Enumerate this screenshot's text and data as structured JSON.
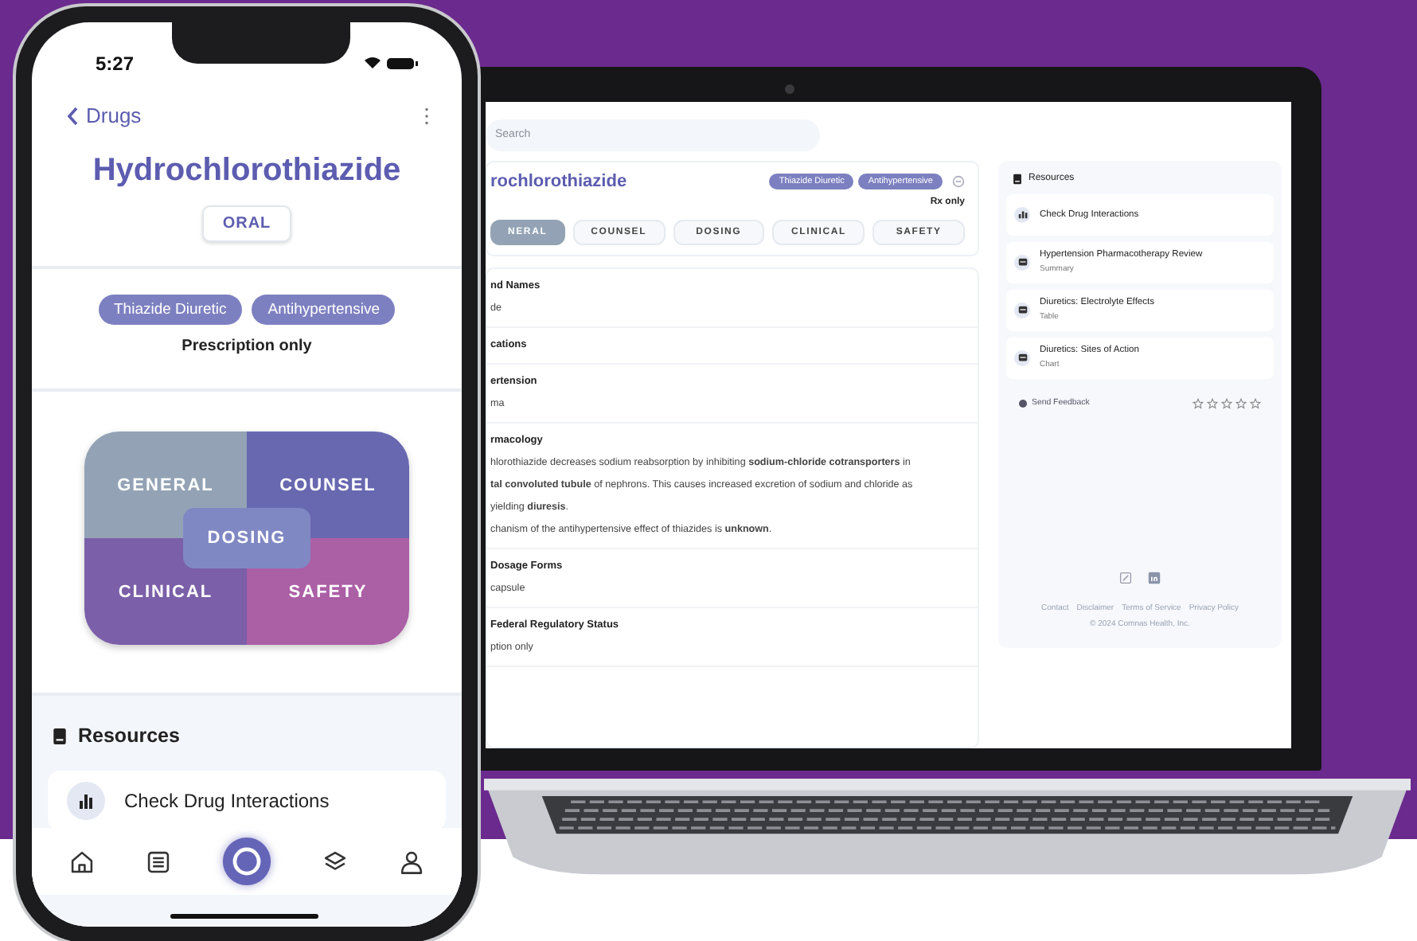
{
  "laptop": {
    "search": {
      "placeholder": "Search"
    },
    "drug": {
      "title": "rochlorothiazide",
      "tags": [
        "Thiazide Diuretic",
        "Antihypertensive"
      ],
      "rx": "Rx only"
    },
    "tabs": [
      {
        "label": "NERAL",
        "selected": true
      },
      {
        "label": "COUNSEL",
        "selected": false
      },
      {
        "label": "DOSING",
        "selected": false
      },
      {
        "label": "CLINICAL",
        "selected": false
      },
      {
        "label": "SAFETY",
        "selected": false
      }
    ],
    "sections": [
      {
        "heading": "nd Names",
        "lines": [
          "de"
        ]
      },
      {
        "heading": "cations"
      },
      {
        "heading": "ertension",
        "lines": [
          "ma"
        ]
      },
      {
        "heading": "rmacology",
        "lines": [
          "hlorothiazide decreases sodium reabsorption by inhibiting **sodium-chloride cotransporters** in",
          "**tal convoluted tubule** of nephrons. This causes increased excretion of sodium and chloride as",
          "yielding **diuresis**.",
          "chanism of the antihypertensive effect of thiazides is **unknown**."
        ]
      },
      {
        "heading": "Dosage Forms",
        "lines": [
          "capsule"
        ]
      },
      {
        "heading": "Federal Regulatory Status",
        "lines": [
          "ption only"
        ]
      }
    ],
    "resources": {
      "title": "Resources",
      "items": [
        {
          "title": "Check Drug Interactions",
          "kind": "chart"
        },
        {
          "title": "Hypertension Pharmacotherapy Review",
          "subtitle": "Summary",
          "kind": "doc"
        },
        {
          "title": "Diuretics: Electrolyte Effects",
          "subtitle": "Table",
          "kind": "doc"
        },
        {
          "title": "Diuretics: Sites of Action",
          "subtitle": "Chart",
          "kind": "doc"
        }
      ]
    },
    "feedback": "Send Feedback",
    "stars": 0,
    "footer_links": [
      "Contact",
      "Disclaimer",
      "Terms of Service",
      "Privacy Policy"
    ],
    "copyright": "© 2024 Comnas Health, Inc."
  },
  "phone": {
    "time": "5:27",
    "back": "Drugs",
    "title": "Hydrochlorothiazide",
    "route": "ORAL",
    "tags": [
      "Thiazide Diuretic",
      "Antihypertensive"
    ],
    "rx": "Prescription only",
    "quadrants": [
      {
        "label": "GENERAL",
        "color": "#93a3b5"
      },
      {
        "label": "COUNSEL",
        "color": "#6868b0"
      },
      {
        "label": "CLINICAL",
        "color": "#7b5fa8"
      },
      {
        "label": "SAFETY",
        "color": "#ab5fa5"
      }
    ],
    "center": {
      "label": "DOSING",
      "color": "#8088c4"
    },
    "resources_title": "Resources",
    "resource_item": "Check Drug Interactions",
    "tabbar": [
      {
        "kind": "home",
        "selected": false
      },
      {
        "kind": "list",
        "selected": false
      },
      {
        "kind": "center",
        "selected": true
      },
      {
        "kind": "layers",
        "selected": false
      },
      {
        "kind": "profile",
        "selected": false
      }
    ]
  }
}
